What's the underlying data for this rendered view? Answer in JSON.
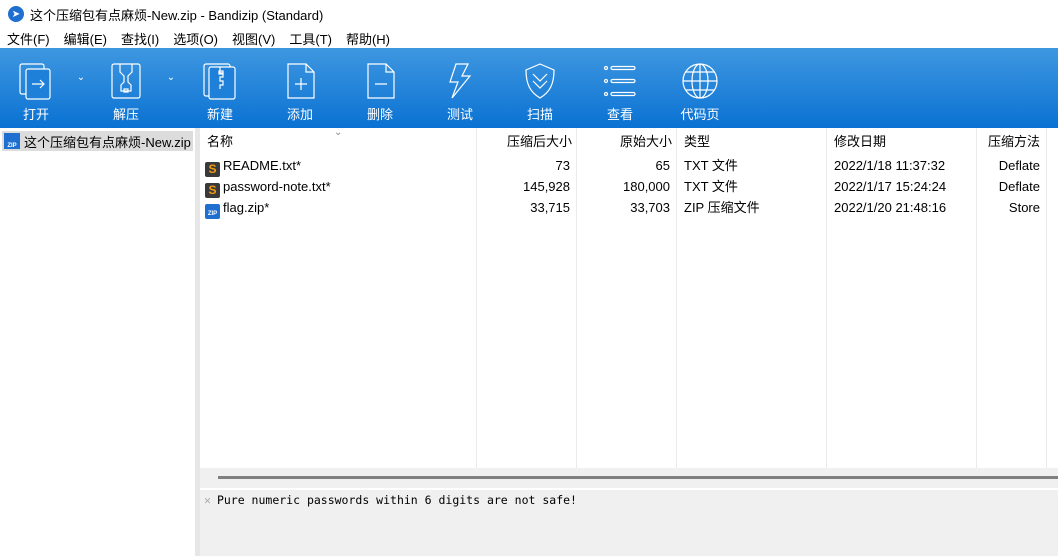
{
  "window": {
    "title": "这个压缩包有点麻烦-New.zip - Bandizip (Standard)"
  },
  "menu": [
    "文件(F)",
    "编辑(E)",
    "查找(I)",
    "选项(O)",
    "视图(V)",
    "工具(T)",
    "帮助(H)"
  ],
  "toolbar": [
    {
      "label": "打开",
      "icon": "open-icon"
    },
    {
      "label": "解压",
      "icon": "extract-icon"
    },
    {
      "label": "新建",
      "icon": "new-archive-icon"
    },
    {
      "label": "添加",
      "icon": "add-file-icon"
    },
    {
      "label": "删除",
      "icon": "delete-file-icon"
    },
    {
      "label": "测试",
      "icon": "lightning-icon"
    },
    {
      "label": "扫描",
      "icon": "shield-icon"
    },
    {
      "label": "查看",
      "icon": "list-icon"
    },
    {
      "label": "代码页",
      "icon": "globe-icon"
    }
  ],
  "tree": {
    "item": "这个压缩包有点麻烦-New.zip"
  },
  "columns": [
    "名称",
    "压缩后大小",
    "原始大小",
    "类型",
    "修改日期",
    "压缩方法"
  ],
  "files": [
    {
      "name": "README.txt*",
      "packed": "73",
      "size": "65",
      "type": "TXT 文件",
      "date": "2022/1/18 11:37:32",
      "method": "Deflate",
      "icon": "txt"
    },
    {
      "name": "password-note.txt*",
      "packed": "145,928",
      "size": "180,000",
      "type": "TXT 文件",
      "date": "2022/1/17 15:24:24",
      "method": "Deflate",
      "icon": "txt"
    },
    {
      "name": "flag.zip*",
      "packed": "33,715",
      "size": "33,703",
      "type": "ZIP 压缩文件",
      "date": "2022/1/20 21:48:16",
      "method": "Store",
      "icon": "zip"
    }
  ],
  "message": "Pure numeric passwords within 6 digits are not safe!",
  "colors": {
    "toolbar_top": "#3f97e0",
    "toolbar_bottom": "#0a72d3"
  }
}
